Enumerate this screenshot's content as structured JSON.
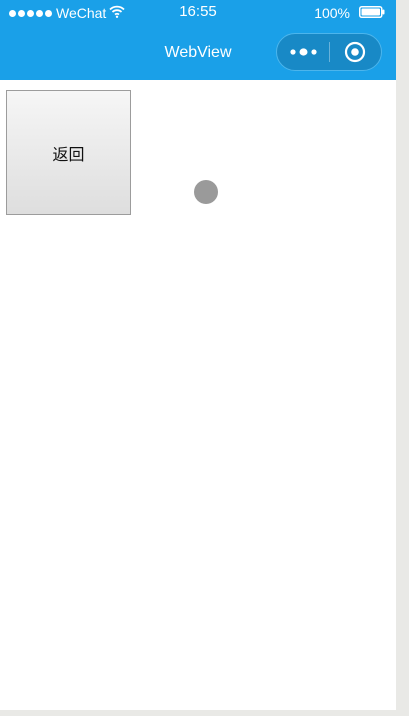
{
  "status_bar": {
    "carrier": "WeChat",
    "time": "16:55",
    "battery": "100%",
    "signal_icon": "signal-dots-icon",
    "wifi_icon": "wifi-icon",
    "battery_icon": "battery-icon"
  },
  "nav_bar": {
    "title": "WebView",
    "more_icon": "more-dots-icon",
    "close_icon": "target-icon"
  },
  "main": {
    "back_label": "返回"
  },
  "colors": {
    "brand": "#1aa0e8",
    "capsule": "#1889c6",
    "button_border": "#9c9c9c",
    "indicator": "#9a9a9a"
  }
}
